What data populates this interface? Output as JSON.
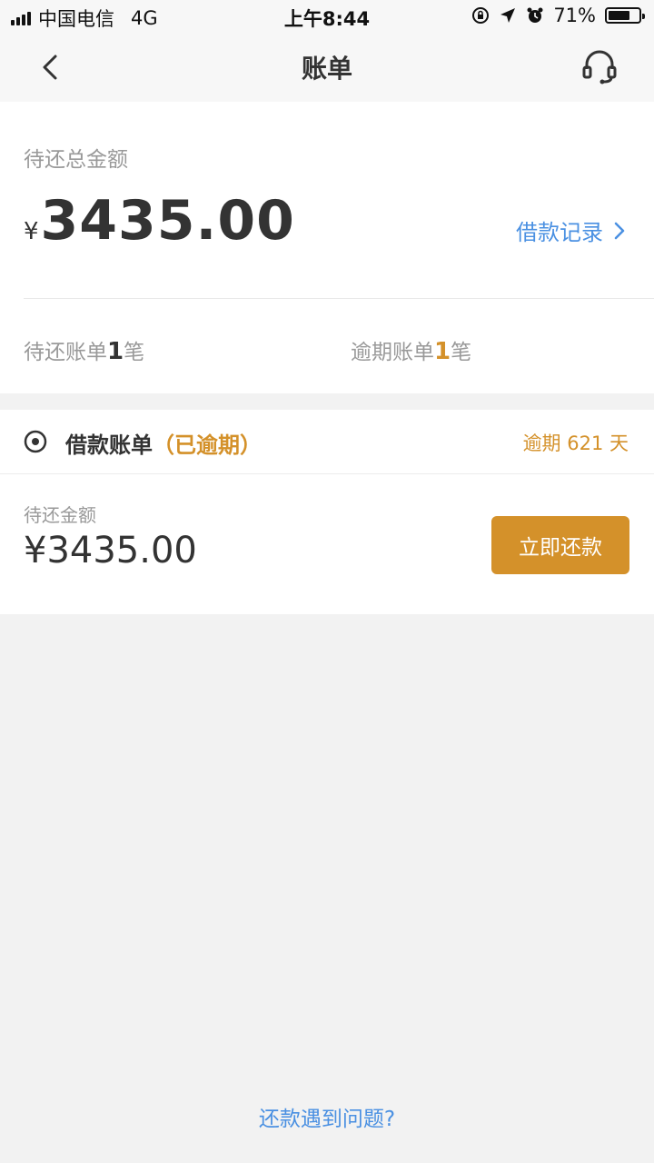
{
  "status_bar": {
    "carrier": "中国电信",
    "network": "4G",
    "time": "上午8:44",
    "battery_percent": "71%",
    "battery_level": 0.71
  },
  "nav": {
    "title": "账单",
    "back_icon": "chevron-left-icon",
    "service_icon": "headset-icon"
  },
  "summary": {
    "label": "待还总金额",
    "currency": "¥",
    "amount": "3435.00",
    "loan_record_label": "借款记录",
    "pending": {
      "prefix": "待还账单",
      "count": "1",
      "suffix": "笔"
    },
    "overdue": {
      "prefix": "逾期账单",
      "count": "1",
      "suffix": "笔"
    }
  },
  "bill": {
    "title": "借款账单",
    "status": "（已逾期）",
    "overdue_days": "逾期 621 天",
    "amount_label": "待还金额",
    "amount": "¥3435.00",
    "repay_button": "立即还款"
  },
  "footer": {
    "help_link": "还款遇到问题?"
  },
  "colors": {
    "accent_orange": "#d4912a",
    "link_blue": "#4a90e2",
    "background": "#f2f2f2"
  }
}
